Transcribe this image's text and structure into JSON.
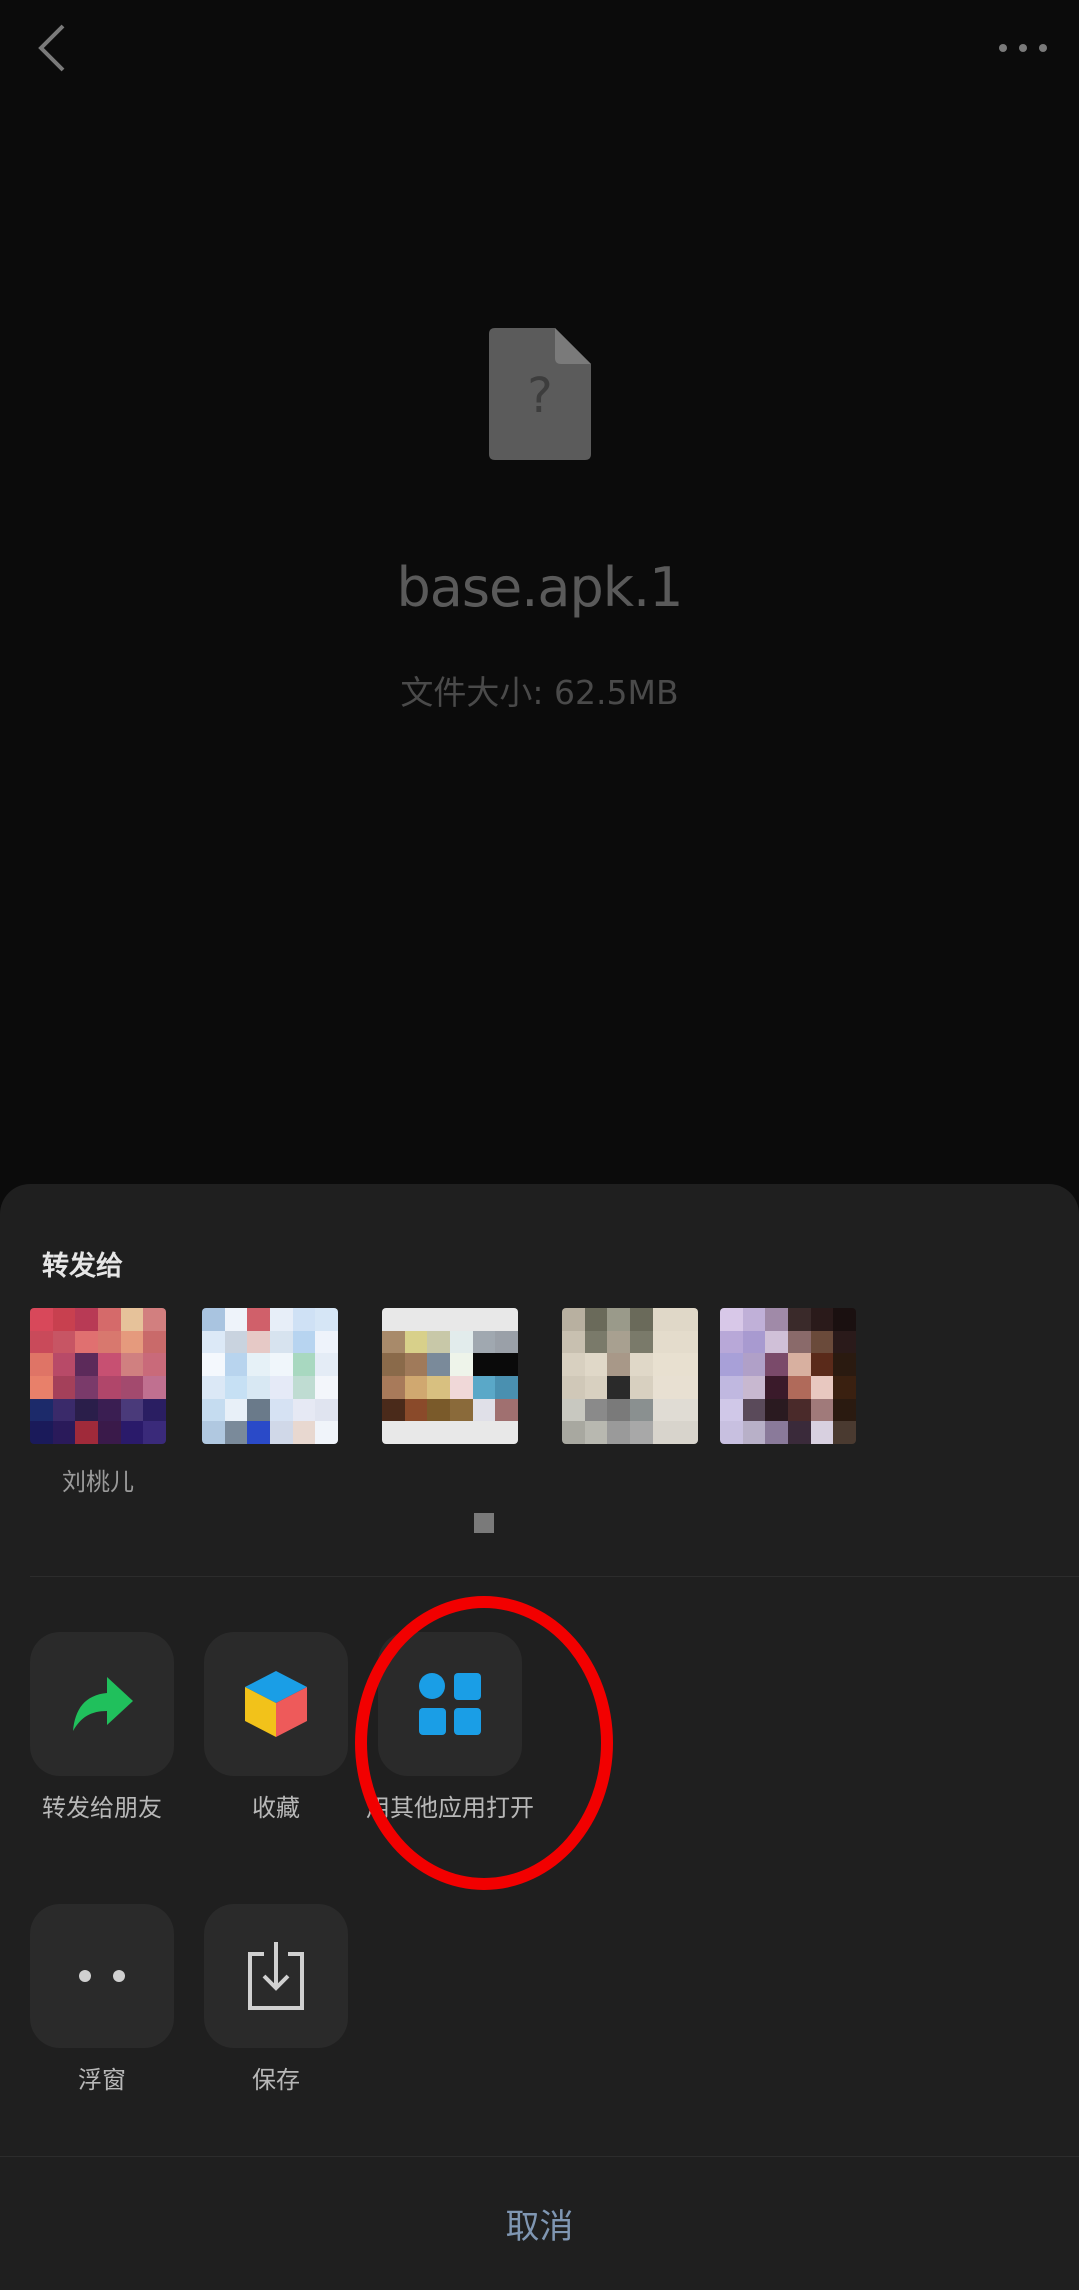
{
  "file": {
    "name": "base.apk.1",
    "size_text": "文件大小: 62.5MB",
    "icon": "unknown-file-icon"
  },
  "topbar": {
    "back_icon": "chevron-left-icon",
    "more_icon": "more-dots-icon"
  },
  "sheet": {
    "title": "转发给",
    "contacts": [
      {
        "name": "刘桃儿"
      },
      {
        "name": ""
      },
      {
        "name": ""
      },
      {
        "name": ""
      },
      {
        "name": ""
      }
    ],
    "actions": [
      {
        "label": "转发给朋友",
        "icon": "forward-arrow-icon"
      },
      {
        "label": "收藏",
        "icon": "favorite-cube-icon"
      },
      {
        "label": "用其他应用打开",
        "icon": "open-with-apps-icon"
      },
      {
        "label": "浮窗",
        "icon": "floating-window-icon"
      },
      {
        "label": "保存",
        "icon": "save-download-icon"
      }
    ],
    "cancel_label": "取消"
  },
  "colors": {
    "highlight": "#f20000",
    "forward_green": "#20c05c",
    "apps_blue": "#1a9ee6",
    "cancel_text": "#7f96b2"
  }
}
